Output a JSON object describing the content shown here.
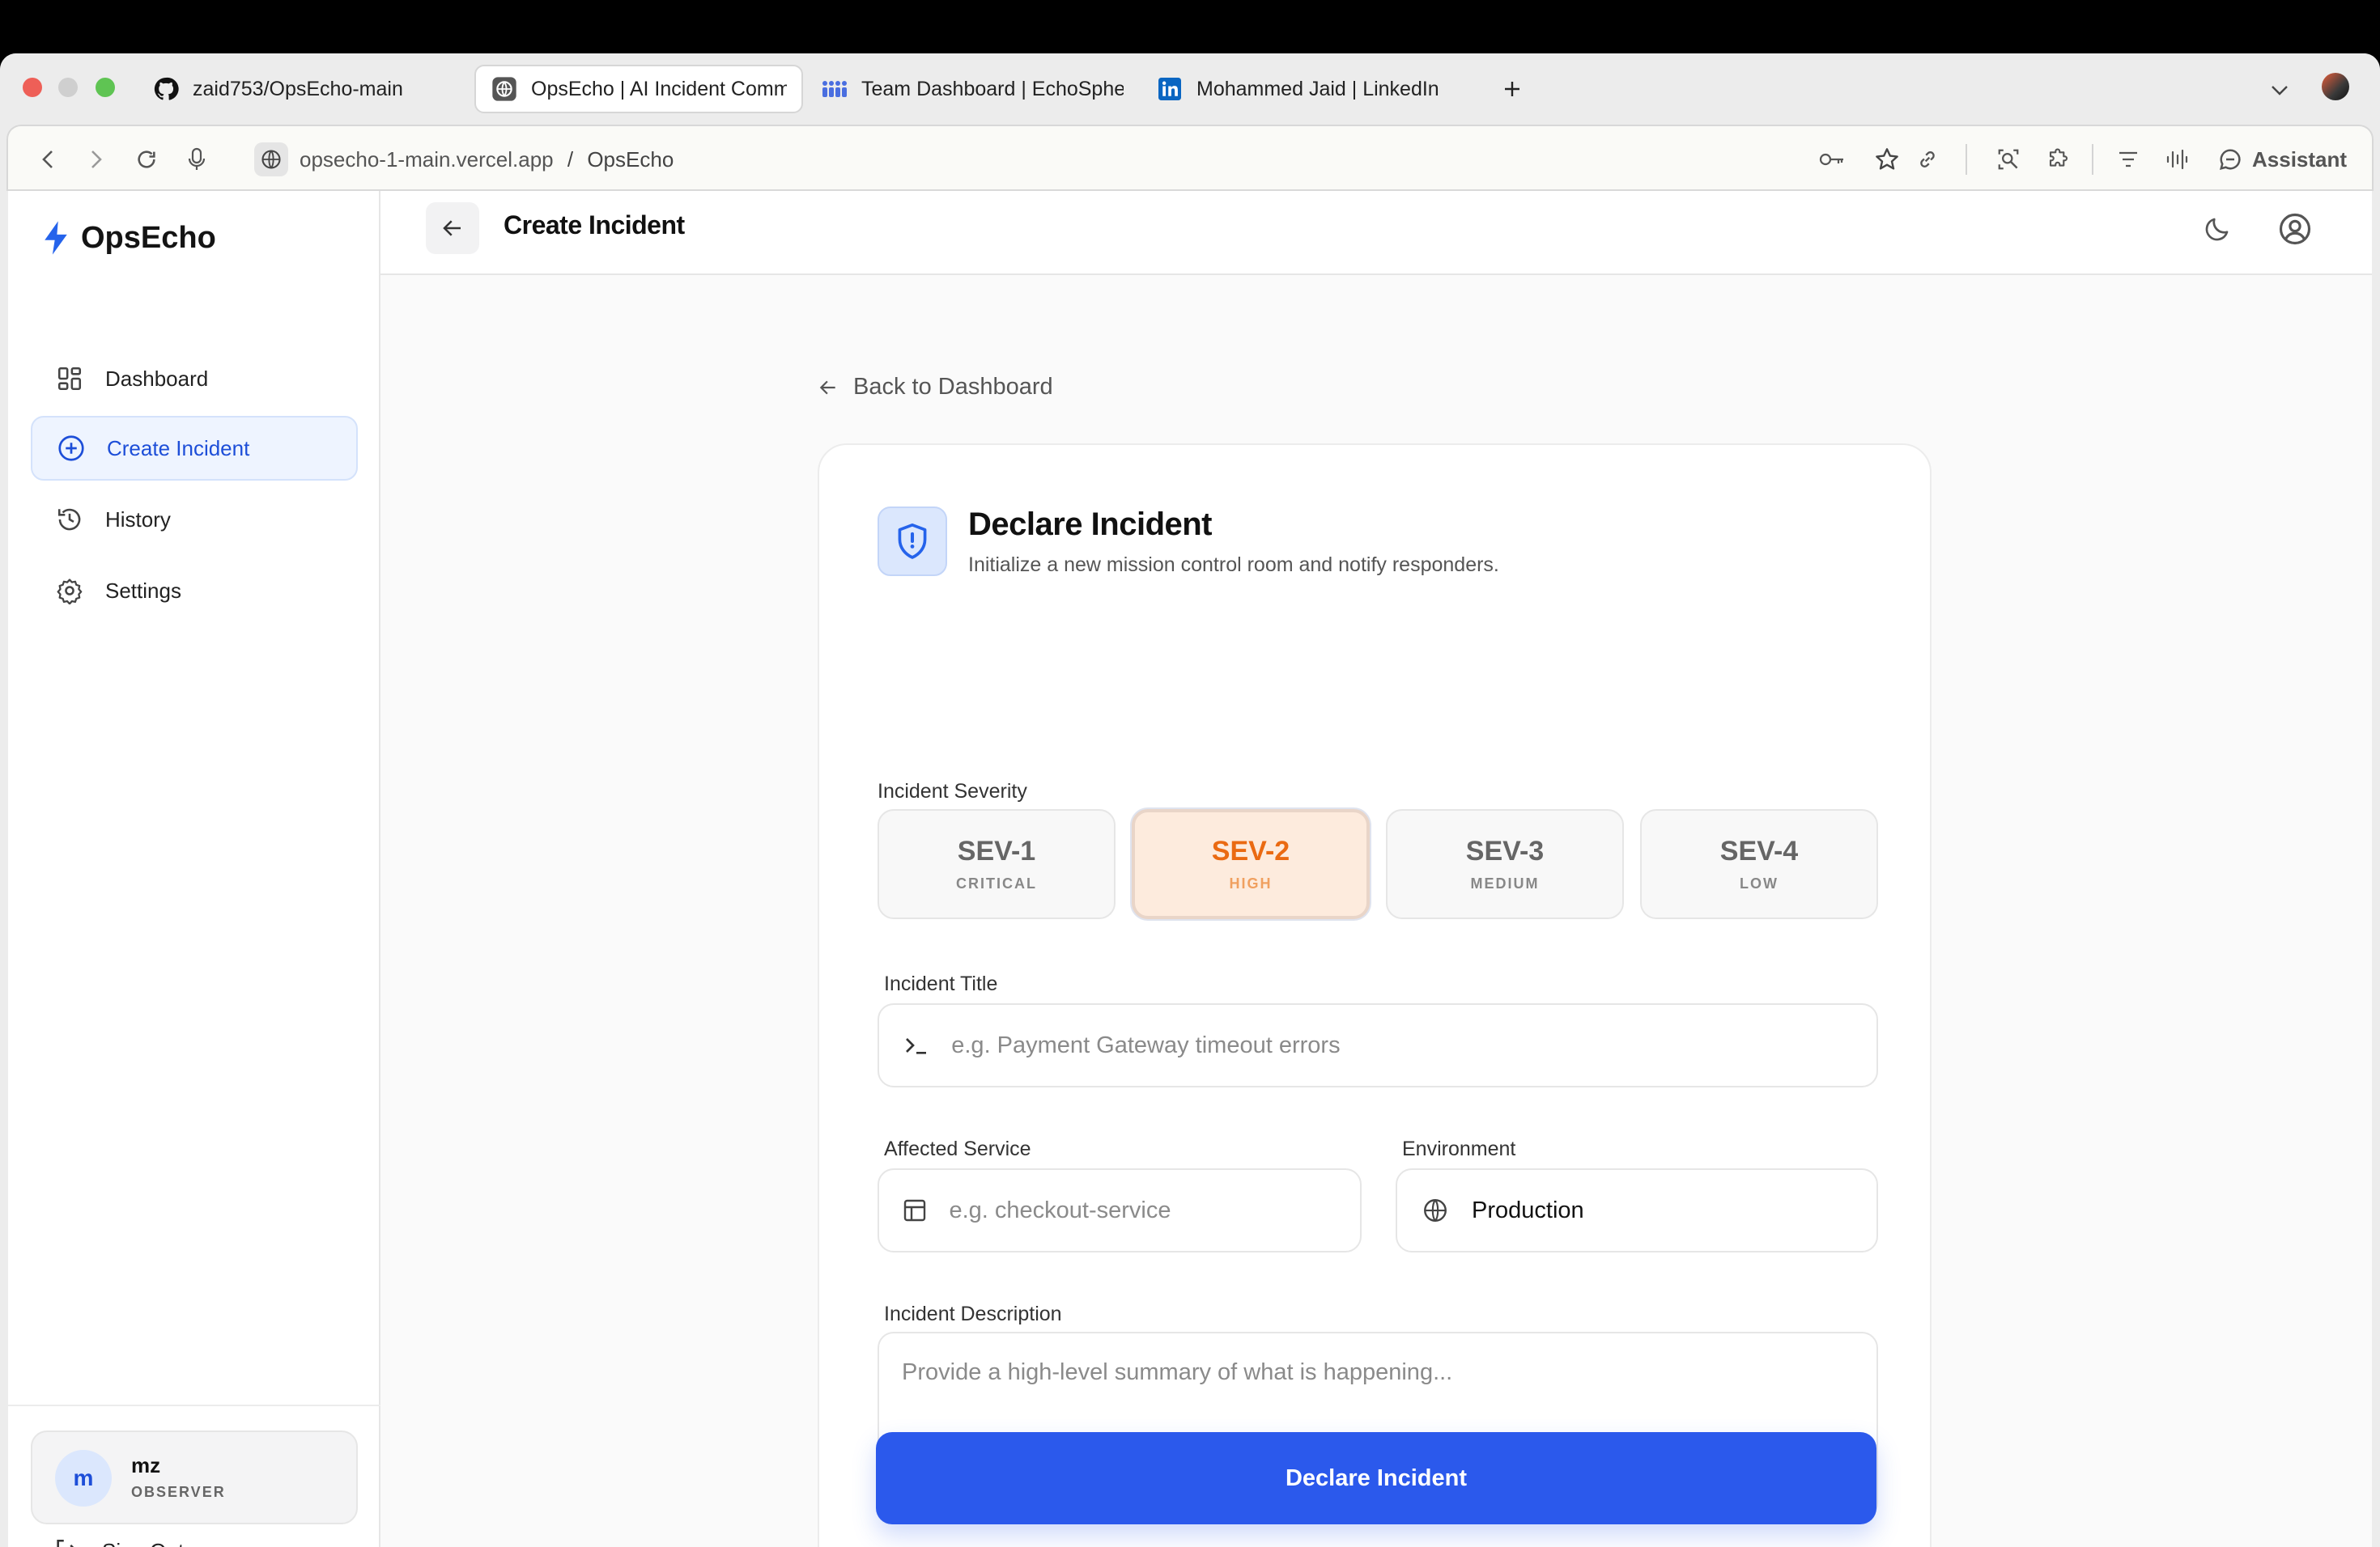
{
  "browser": {
    "tabs": [
      {
        "title": "zaid753/OpsEcho-main",
        "icon": "github-icon"
      },
      {
        "title": "OpsEcho | AI Incident Comm",
        "icon": "globe-icon",
        "active": true
      },
      {
        "title": "Team Dashboard | EchoSphe",
        "icon": "team-icon"
      },
      {
        "title": "Mohammed Jaid | LinkedIn",
        "icon": "linkedin-icon"
      }
    ],
    "url_host": "opsecho-1-main.vercel.app",
    "url_sep": "/",
    "url_page": "OpsEcho",
    "assistant_label": "Assistant"
  },
  "sidebar": {
    "logo": "OpsEcho",
    "items": [
      {
        "label": "Dashboard",
        "icon": "dashboard-icon"
      },
      {
        "label": "Create Incident",
        "icon": "plus-circle-icon",
        "active": true
      },
      {
        "label": "History",
        "icon": "history-icon"
      },
      {
        "label": "Settings",
        "icon": "gear-icon"
      }
    ],
    "user": {
      "initial": "m",
      "name": "mz",
      "role": "OBSERVER"
    },
    "signout": "Sign Out"
  },
  "header": {
    "title": "Create Incident"
  },
  "main": {
    "back_link": "Back to Dashboard",
    "card_title": "Declare Incident",
    "card_subtitle": "Initialize a new mission control room and notify responders.",
    "severity_label": "Incident Severity",
    "severities": [
      {
        "code": "SEV-1",
        "level": "CRITICAL"
      },
      {
        "code": "SEV-2",
        "level": "HIGH",
        "selected": true
      },
      {
        "code": "SEV-3",
        "level": "MEDIUM"
      },
      {
        "code": "SEV-4",
        "level": "LOW"
      }
    ],
    "title_label": "Incident Title",
    "title_placeholder": "e.g. Payment Gateway timeout errors",
    "title_value": "",
    "service_label": "Affected Service",
    "service_placeholder": "e.g. checkout-service",
    "service_value": "",
    "environment_label": "Environment",
    "environment_value": "Production",
    "description_label": "Incident Description",
    "description_placeholder": "Provide a high-level summary of what is happening...",
    "description_value": "",
    "submit_label": "Declare Incident"
  },
  "colors": {
    "accent": "#2b59ec",
    "sev2": "#ea6a12",
    "nav_active": "#1d4ed8"
  }
}
